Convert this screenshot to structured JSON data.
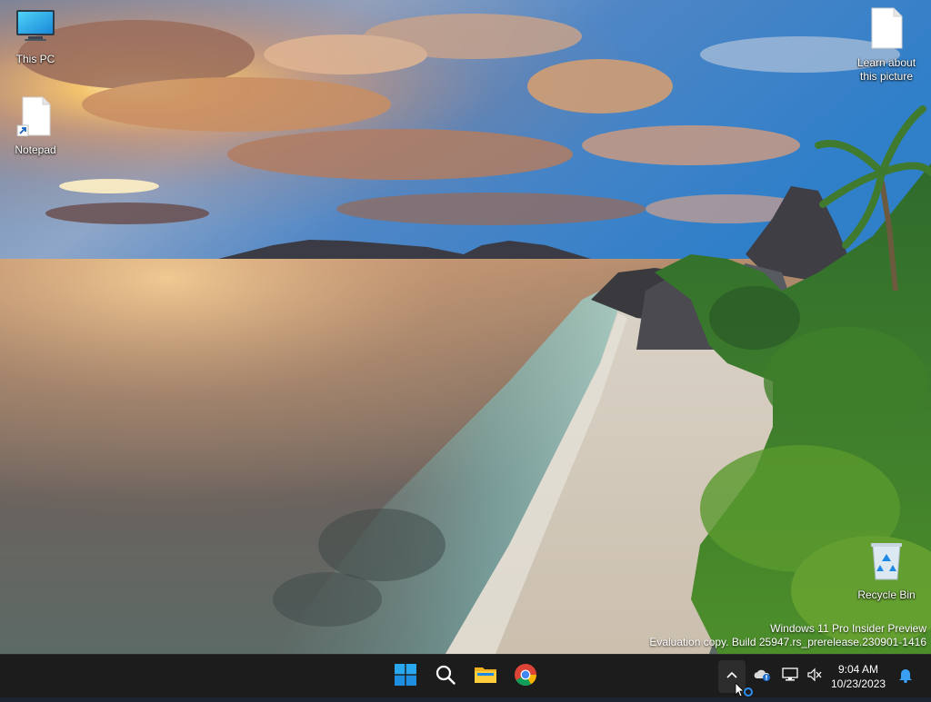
{
  "desktop": {
    "icons": [
      {
        "label": "This PC",
        "icon": "monitor-icon"
      },
      {
        "label": "Notepad",
        "icon": "notepad-shortcut-icon"
      },
      {
        "label": "Learn about this picture",
        "icon": "document-icon"
      },
      {
        "label": "Recycle Bin",
        "icon": "recycle-bin-icon"
      }
    ]
  },
  "watermark": {
    "line1": "Windows 11 Pro Insider Preview",
    "line2": "Evaluation copy. Build 25947.rs_prerelease.230901-1416"
  },
  "taskbar": {
    "pinned": [
      {
        "name": "Start",
        "icon": "windows-start-icon"
      },
      {
        "name": "Search",
        "icon": "search-icon"
      },
      {
        "name": "File Explorer",
        "icon": "folder-icon"
      },
      {
        "name": "Google Chrome",
        "icon": "chrome-icon"
      }
    ],
    "tray": {
      "icons": [
        "chevron-up-icon",
        "onedrive-icon",
        "network-icon",
        "speaker-muted-icon",
        "notification-bell-icon"
      ],
      "time": "9:04 AM",
      "date": "10/23/2023"
    }
  },
  "colors": {
    "taskbar_bg": "#1c1c1c",
    "accent": "#0078d4",
    "text": "#ffffff"
  }
}
